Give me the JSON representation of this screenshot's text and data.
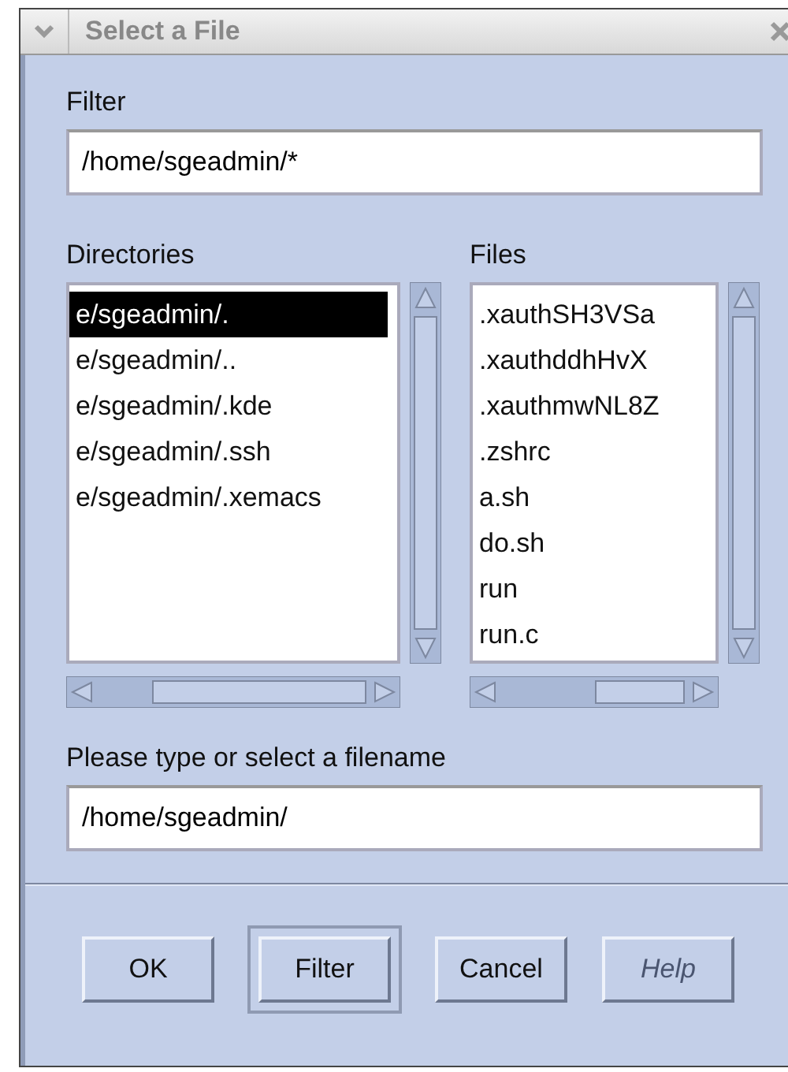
{
  "window": {
    "title": "Select a File"
  },
  "filter": {
    "label": "Filter",
    "value": "/home/sgeadmin/*"
  },
  "directories": {
    "label": "Directories",
    "items": [
      {
        "name": "e/sgeadmin/.",
        "selected": true
      },
      {
        "name": "e/sgeadmin/..",
        "selected": false
      },
      {
        "name": "e/sgeadmin/.kde",
        "selected": false
      },
      {
        "name": "e/sgeadmin/.ssh",
        "selected": false
      },
      {
        "name": "e/sgeadmin/.xemacs",
        "selected": false
      }
    ]
  },
  "files": {
    "label": "Files",
    "items": [
      {
        "name": ".xauthSH3VSa",
        "selected": false
      },
      {
        "name": ".xauthddhHvX",
        "selected": false
      },
      {
        "name": ".xauthmwNL8Z",
        "selected": false
      },
      {
        "name": ".zshrc",
        "selected": false
      },
      {
        "name": "a.sh",
        "selected": false
      },
      {
        "name": "do.sh",
        "selected": false
      },
      {
        "name": "run",
        "selected": false
      },
      {
        "name": "run.c",
        "selected": false
      }
    ]
  },
  "selection": {
    "label": "Please type or select a filename",
    "value": "/home/sgeadmin/"
  },
  "buttons": [
    {
      "label": "OK",
      "default": false,
      "disabled": false
    },
    {
      "label": "Filter",
      "default": true,
      "disabled": false
    },
    {
      "label": "Cancel",
      "default": false,
      "disabled": false
    },
    {
      "label": "Help",
      "default": false,
      "disabled": true
    }
  ]
}
